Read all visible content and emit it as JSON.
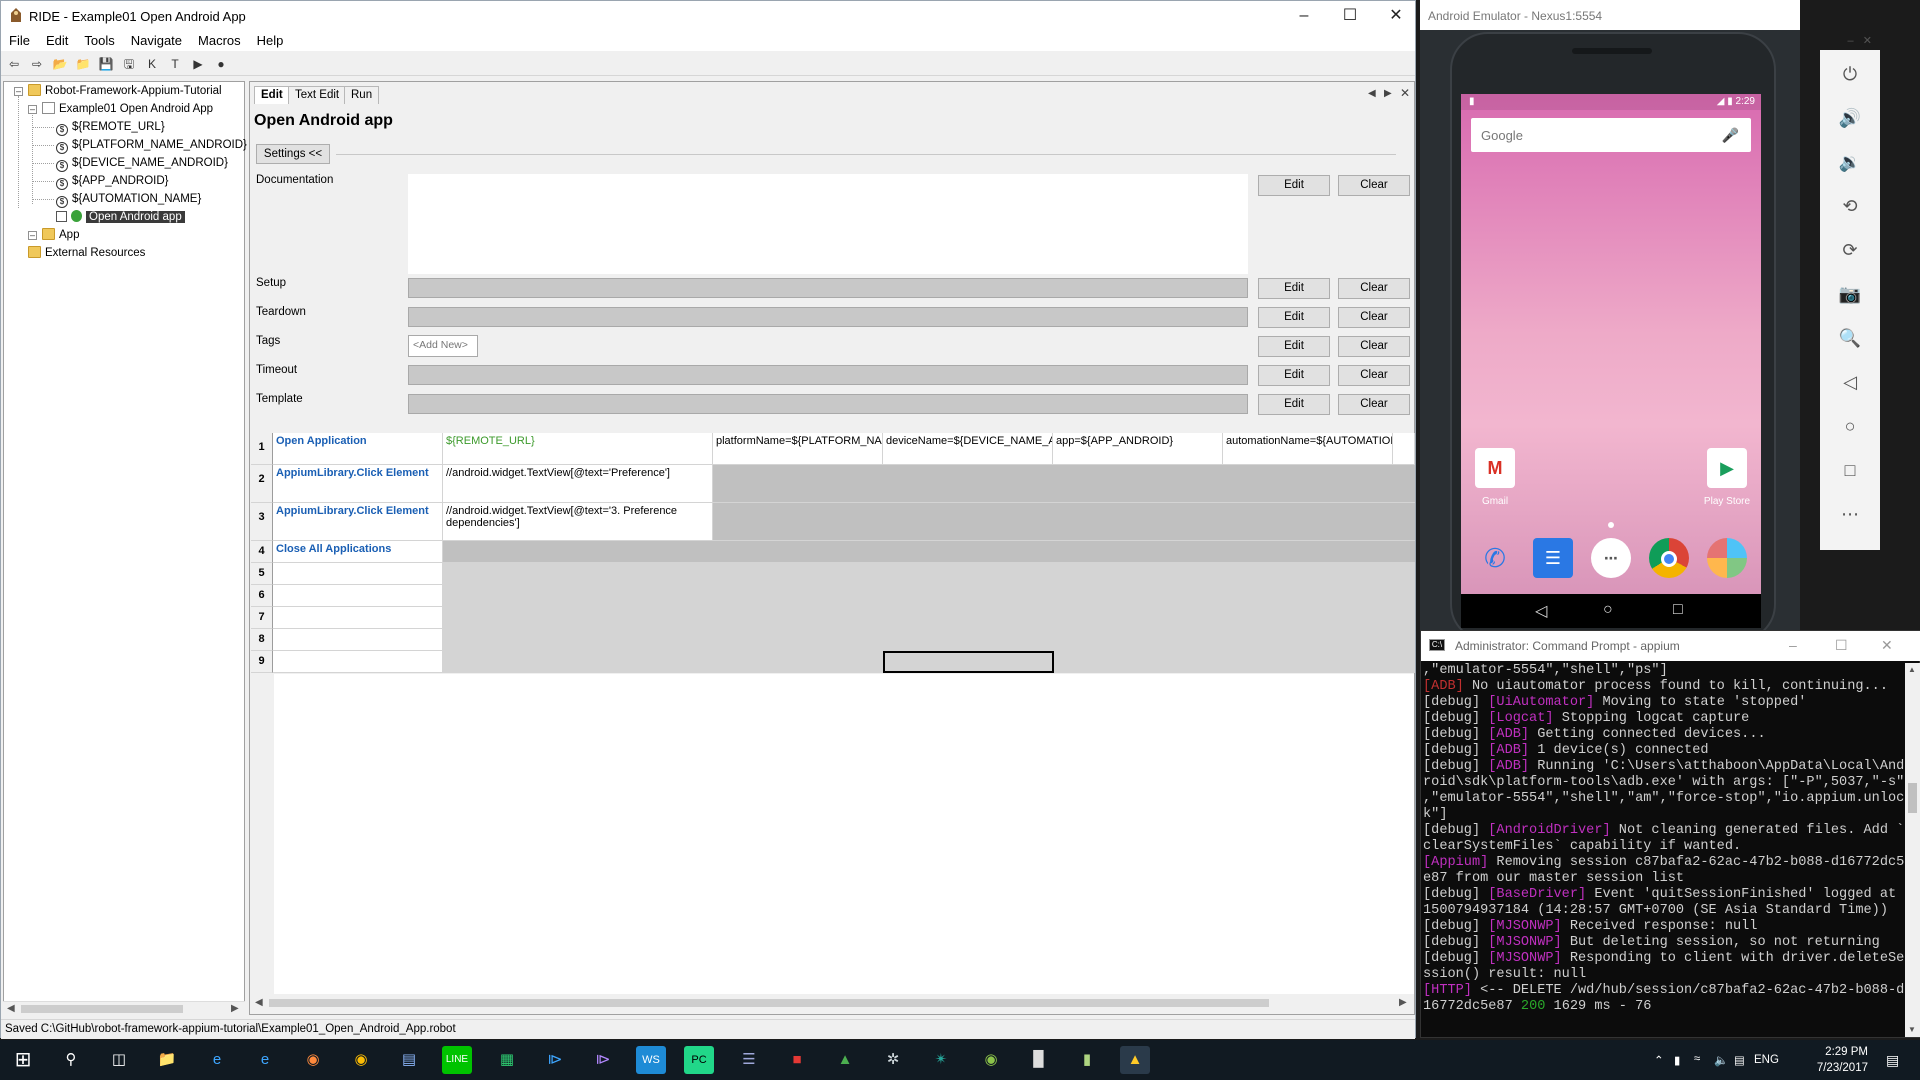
{
  "ride": {
    "title": "RIDE - Example01 Open Android App",
    "menu": [
      "File",
      "Edit",
      "Tools",
      "Navigate",
      "Macros",
      "Help"
    ],
    "tree": {
      "project": "Robot-Framework-Appium-Tutorial",
      "suite": "Example01 Open Android App",
      "variables": [
        "${REMOTE_URL}",
        "${PLATFORM_NAME_ANDROID}",
        "${DEVICE_NAME_ANDROID}",
        "${APP_ANDROID}",
        "${AUTOMATION_NAME}"
      ],
      "test": "Open Android app",
      "folder": "App",
      "external": "External Resources"
    },
    "tabs": [
      "Edit",
      "Text Edit",
      "Run"
    ],
    "page_title": "Open Android app",
    "settings_button": "Settings <<",
    "settings": {
      "documentation": "Documentation",
      "setup": "Setup",
      "teardown": "Teardown",
      "tags": "Tags",
      "tags_placeholder": "<Add New>",
      "timeout": "Timeout",
      "template": "Template",
      "edit": "Edit",
      "clear": "Clear"
    },
    "grid": {
      "row_numbers": [
        "1",
        "2",
        "3",
        "4",
        "5",
        "6",
        "7",
        "8",
        "9"
      ],
      "row1": [
        "Open Application",
        "${REMOTE_URL}",
        "platformName=${PLATFORM_NAM",
        "deviceName=${DEVICE_NAME_AN",
        "app=${APP_ANDROID}",
        "automationName=${AUTOMATION"
      ],
      "row2": [
        "AppiumLibrary.Click Element",
        "//android.widget.TextView[@text='Preference']"
      ],
      "row3": [
        "AppiumLibrary.Click Element",
        "//android.widget.TextView[@text='3. Preference dependencies']"
      ],
      "row4": [
        "Close All Applications"
      ]
    },
    "status": "Saved C:\\GitHub\\robot-framework-appium-tutorial\\Example01_Open_Android_App.robot"
  },
  "emulator": {
    "title": "Android Emulator - Nexus1:5554",
    "time": "2:29",
    "search_label": "Google",
    "apps": [
      "Gmail",
      "Play Store"
    ]
  },
  "cmd": {
    "title": "Administrator: Command Prompt - appium",
    "lines": [
      [
        {
          "t": ",\"emulator-5554\",\"shell\",\"ps\"]"
        }
      ],
      [
        {
          "t": "[ADB]",
          "c": "tag2"
        },
        {
          "t": " No uiautomator process found to kill, continuing..."
        }
      ],
      [
        {
          "t": "[debug] "
        },
        {
          "t": "[UiAutomator]",
          "c": "tag"
        },
        {
          "t": " Moving to state 'stopped'"
        }
      ],
      [
        {
          "t": "[debug] "
        },
        {
          "t": "[Logcat]",
          "c": "tag"
        },
        {
          "t": " Stopping logcat capture"
        }
      ],
      [
        {
          "t": "[debug] "
        },
        {
          "t": "[ADB]",
          "c": "tag"
        },
        {
          "t": " Getting connected devices..."
        }
      ],
      [
        {
          "t": "[debug] "
        },
        {
          "t": "[ADB]",
          "c": "tag"
        },
        {
          "t": " 1 device(s) connected"
        }
      ],
      [
        {
          "t": "[debug] "
        },
        {
          "t": "[ADB]",
          "c": "tag"
        },
        {
          "t": " Running 'C:\\Users\\atthaboon\\AppData\\Local\\And"
        }
      ],
      [
        {
          "t": "roid\\sdk\\platform-tools\\adb.exe' with args: [\"-P\",5037,\"-s\""
        }
      ],
      [
        {
          "t": ",\"emulator-5554\",\"shell\",\"am\",\"force-stop\",\"io.appium.unloc"
        }
      ],
      [
        {
          "t": "k\"]"
        }
      ],
      [
        {
          "t": "[debug] "
        },
        {
          "t": "[AndroidDriver]",
          "c": "tag"
        },
        {
          "t": " Not cleaning generated files. Add `"
        }
      ],
      [
        {
          "t": "clearSystemFiles` capability if wanted."
        }
      ],
      [
        {
          "t": "[Appium]",
          "c": "tag"
        },
        {
          "t": " Removing session c87bafa2-62ac-47b2-b088-d16772dc5"
        }
      ],
      [
        {
          "t": "e87 from our master session list"
        }
      ],
      [
        {
          "t": "[debug] "
        },
        {
          "t": "[BaseDriver]",
          "c": "tag"
        },
        {
          "t": " Event 'quitSessionFinished' logged at"
        }
      ],
      [
        {
          "t": "1500794937184 (14:28:57 GMT+0700 (SE Asia Standard Time))"
        }
      ],
      [
        {
          "t": "[debug] "
        },
        {
          "t": "[MJSONWP]",
          "c": "tag"
        },
        {
          "t": " Received response: null"
        }
      ],
      [
        {
          "t": "[debug] "
        },
        {
          "t": "[MJSONWP]",
          "c": "tag"
        },
        {
          "t": " But deleting session, so not returning"
        }
      ],
      [
        {
          "t": "[debug] "
        },
        {
          "t": "[MJSONWP]",
          "c": "tag"
        },
        {
          "t": " Responding to client with driver.deleteSe"
        }
      ],
      [
        {
          "t": "ssion() result: null"
        }
      ],
      [
        {
          "t": "[HTTP]",
          "c": "tag"
        },
        {
          "t": " <-- DELETE /wd/hub/session/c87bafa2-62ac-47b2-b088-d"
        }
      ],
      [
        {
          "t": "16772dc5e87 "
        },
        {
          "t": "200",
          "c": "ok"
        },
        {
          "t": " 1629 ms - 76"
        }
      ]
    ]
  },
  "tray": {
    "lang": "ENG",
    "time": "2:29 PM",
    "date": "7/23/2017"
  }
}
